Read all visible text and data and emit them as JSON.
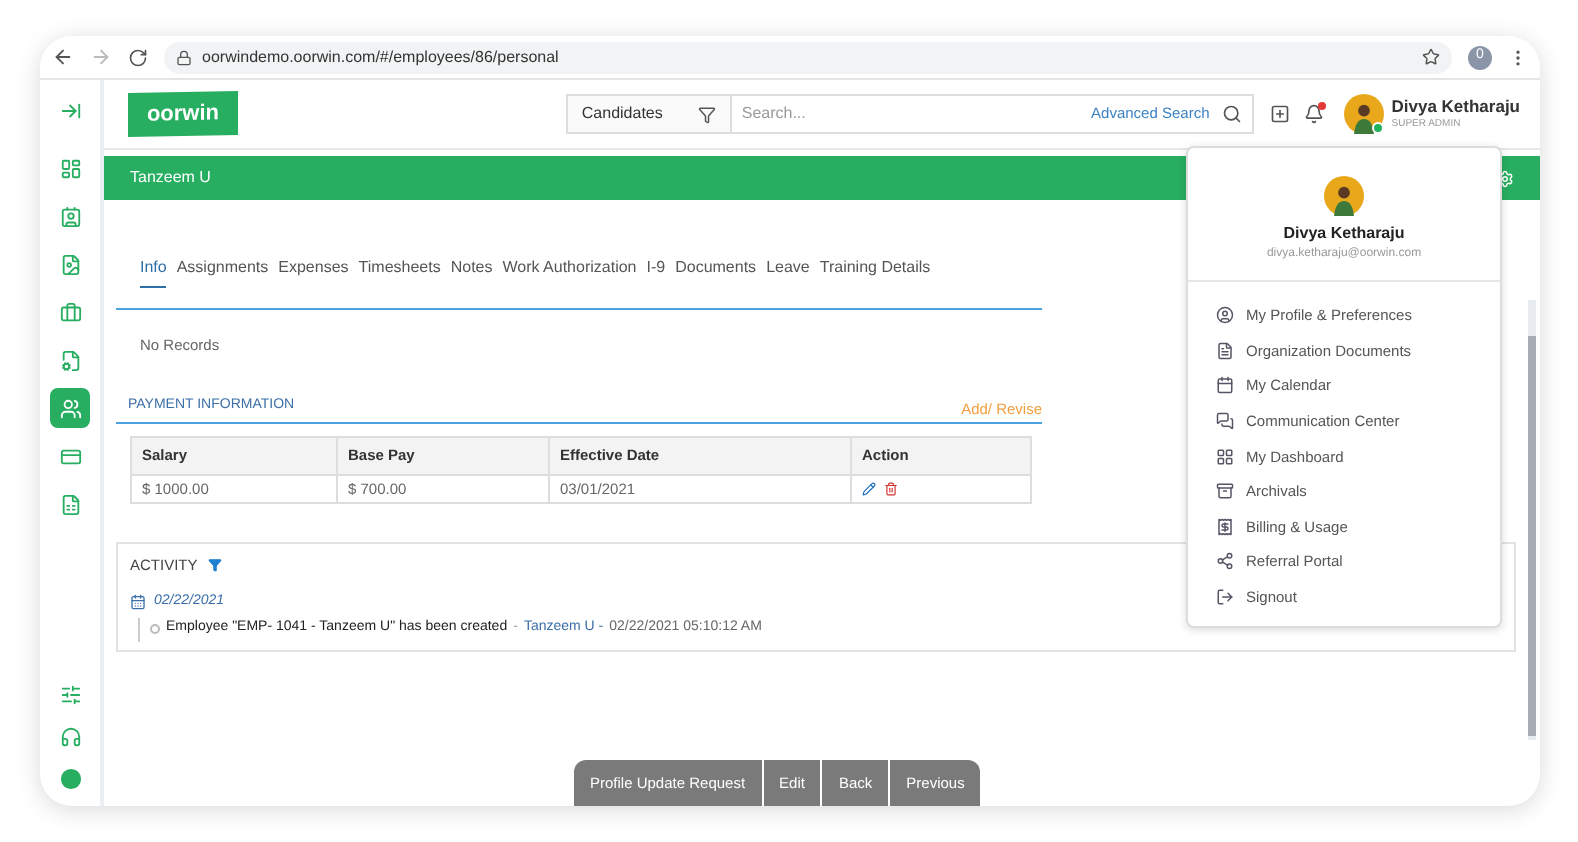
{
  "browser": {
    "url": "oorwindemo.oorwin.com/#/employees/86/personal",
    "profile_initial": "0"
  },
  "sidebar": {
    "items": [
      {
        "selected": false
      },
      {
        "selected": false
      },
      {
        "selected": false
      },
      {
        "selected": false
      },
      {
        "selected": false
      },
      {
        "selected": true
      },
      {
        "selected": false
      },
      {
        "selected": false
      }
    ]
  },
  "header": {
    "logo": "oorwin",
    "search_scope": "Candidates",
    "search": {
      "placeholder": "Search..."
    },
    "advanced_search": "Advanced Search",
    "notification_dot": true,
    "user": {
      "name": "Divya Ketharaju",
      "role": "SUPER ADMIN",
      "online": true
    }
  },
  "employee_bar": {
    "name": "Tanzeem U"
  },
  "tabs": [
    {
      "label": "Info",
      "selected": true
    },
    {
      "label": "Assignments",
      "selected": false
    },
    {
      "label": "Expenses",
      "selected": false
    },
    {
      "label": "Timesheets",
      "selected": false
    },
    {
      "label": "Notes",
      "selected": false
    },
    {
      "label": "Work Authorization",
      "selected": false
    },
    {
      "label": "I-9",
      "selected": false
    },
    {
      "label": "Documents",
      "selected": false
    },
    {
      "label": "Leave",
      "selected": false
    },
    {
      "label": "Training Details",
      "selected": false
    }
  ],
  "empty_message": "No Records",
  "payment": {
    "title": "PAYMENT INFORMATION",
    "action": "Add/ Revise",
    "columns": [
      "Salary",
      "Base Pay",
      "Effective Date",
      "Action"
    ],
    "rows": [
      {
        "cells": [
          "$ 1000.00",
          "$ 700.00",
          "03/01/2021"
        ]
      }
    ]
  },
  "activity": {
    "title": "ACTIVITY",
    "date": "02/22/2021",
    "entries": [
      {
        "message": "Employee \"EMP- 1041 - Tanzeem U\" has been created",
        "separator": "-",
        "author": "Tanzeem U -",
        "time": "02/22/2021 05:10:12 AM"
      }
    ]
  },
  "user_menu": {
    "name": "Divya Ketharaju",
    "email": "divya.ketharaju@oorwin.com",
    "items": [
      "My Profile & Preferences",
      "Organization Documents",
      "My Calendar",
      "Communication Center",
      "My Dashboard",
      "Archivals",
      "Billing & Usage",
      "Referral Portal",
      "Signout"
    ]
  },
  "footer_buttons": [
    "Profile Update Request",
    "Edit",
    "Back",
    "Previous"
  ]
}
